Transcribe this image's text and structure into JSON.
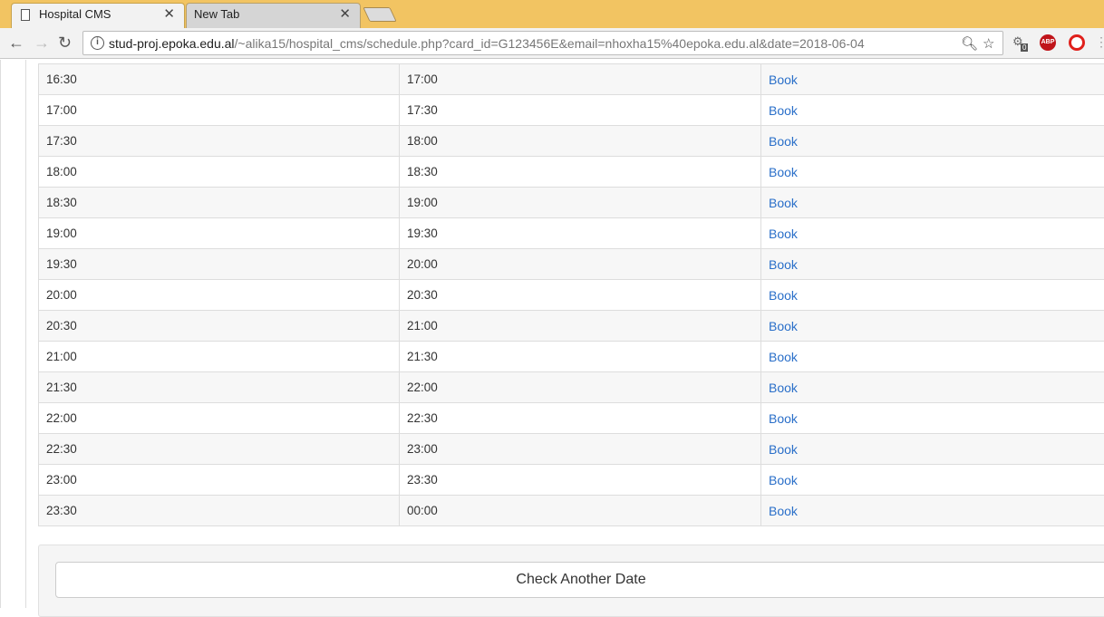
{
  "browser": {
    "tabs": [
      {
        "title": "Hospital CMS",
        "active": true
      },
      {
        "title": "New Tab",
        "active": false
      }
    ],
    "url_host": "stud-proj.epoka.edu.al",
    "url_path": "/~alika15/hospital_cms/schedule.php?card_id=G123456E&email=nhoxha15%40epoka.edu.al&date=2018-06-04",
    "extension_badge": "0",
    "abp_label": "ABP"
  },
  "schedule": {
    "action_label": "Book",
    "rows": [
      {
        "start": "16:30",
        "end": "17:00",
        "action": "Book"
      },
      {
        "start": "17:00",
        "end": "17:30",
        "action": "Book"
      },
      {
        "start": "17:30",
        "end": "18:00",
        "action": "Book"
      },
      {
        "start": "18:00",
        "end": "18:30",
        "action": "Book"
      },
      {
        "start": "18:30",
        "end": "19:00",
        "action": "Book"
      },
      {
        "start": "19:00",
        "end": "19:30",
        "action": "Book"
      },
      {
        "start": "19:30",
        "end": "20:00",
        "action": "Book"
      },
      {
        "start": "20:00",
        "end": "20:30",
        "action": "Book"
      },
      {
        "start": "20:30",
        "end": "21:00",
        "action": "Book"
      },
      {
        "start": "21:00",
        "end": "21:30",
        "action": "Book"
      },
      {
        "start": "21:30",
        "end": "22:00",
        "action": "Book"
      },
      {
        "start": "22:00",
        "end": "22:30",
        "action": "Book"
      },
      {
        "start": "22:30",
        "end": "23:00",
        "action": "Book"
      },
      {
        "start": "23:00",
        "end": "23:30",
        "action": "Book"
      },
      {
        "start": "23:30",
        "end": "00:00",
        "action": "Book"
      }
    ]
  },
  "footer": {
    "check_date_label": "Check Another Date"
  },
  "colors": {
    "tab_strip": "#f2c462",
    "link": "#2a6fc9",
    "stripe": "#f7f7f7"
  }
}
